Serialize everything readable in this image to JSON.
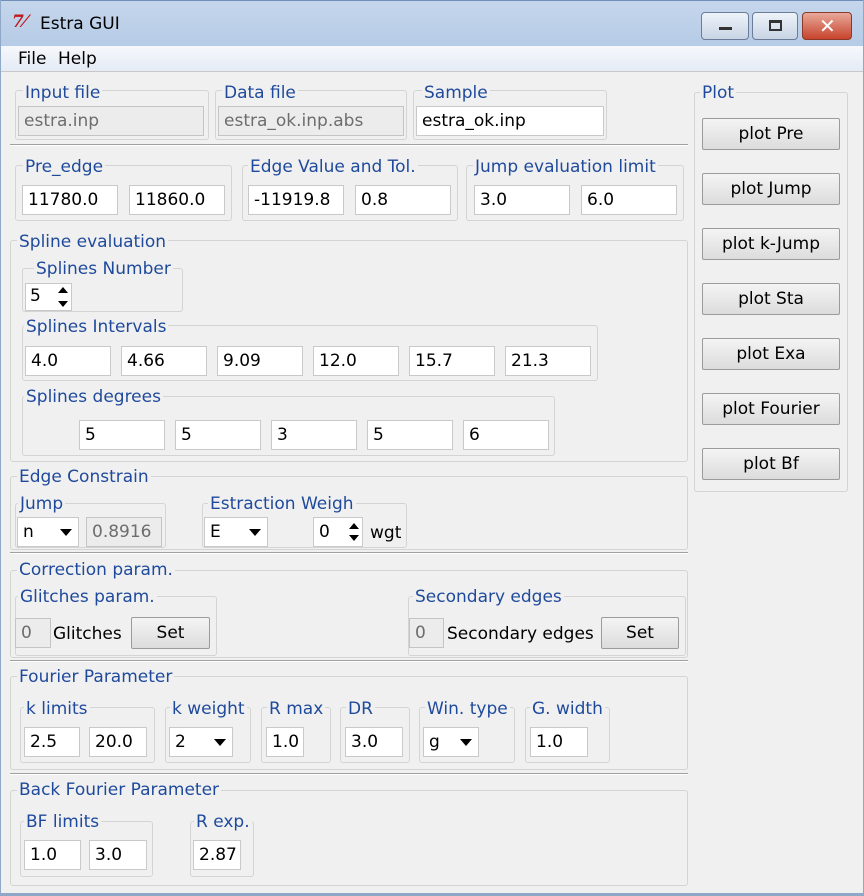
{
  "window": {
    "title": "Estra GUI",
    "icon": "tk-feather-icon"
  },
  "menu": {
    "file": "File",
    "help": "Help"
  },
  "files": {
    "input_label": "Input file",
    "input_value": "estra.inp",
    "data_label": "Data  file",
    "data_value": "estra_ok.inp.abs",
    "sample_label": "Sample",
    "sample_value": "estra_ok.inp"
  },
  "pre_edge": {
    "label": "Pre_edge",
    "v1": "11780.0",
    "v2": "11860.0"
  },
  "edge": {
    "label": "Edge Value and Tol.",
    "v1": "-11919.8",
    "v2": "0.8"
  },
  "jump_limit": {
    "label": "Jump evaluation limit",
    "v1": "3.0",
    "v2": "6.0"
  },
  "spline": {
    "label": "Spline evaluation",
    "number_label": "Splines Number",
    "number_value": "5",
    "intervals_label": "Splines Intervals",
    "intervals": [
      "4.0",
      "4.66",
      "9.09",
      "12.0",
      "15.7",
      "21.3"
    ],
    "degrees_label": "Splines degrees",
    "degrees": [
      "5",
      "5",
      "3",
      "5",
      "6"
    ]
  },
  "edge_constrain": {
    "label": "Edge Constrain",
    "jump_label": "Jump",
    "jump_value": "n",
    "jump_entry": "0.8916",
    "weigh_label": "Estraction Weigh",
    "weigh_value": "E",
    "wgt_value": "0",
    "wgt_label": "wgt"
  },
  "correction": {
    "label": "Correction param.",
    "glitches_label": "Glitches param.",
    "glitches_value": "0",
    "glitches_text": "Glitches",
    "glitches_set": "Set",
    "secondary_label": "Secondary edges",
    "secondary_value": "0",
    "secondary_text": "Secondary edges",
    "secondary_set": "Set"
  },
  "fourier": {
    "label": "Fourier Parameter",
    "klimits_label": "k limits",
    "k1": "2.5",
    "k2": "20.0",
    "kweight_label": "k weight",
    "kweight_value": "2",
    "rmax_label": "R max",
    "rmax_value": "1.0",
    "dr_label": "DR",
    "dr_value": "3.0",
    "wintype_label": "Win. type",
    "wintype_value": "g",
    "gwidth_label": "G. width",
    "gwidth_value": "1.0"
  },
  "back_fourier": {
    "label": "Back Fourier Parameter",
    "bf_label": "BF limits",
    "bf1": "1.0",
    "bf2": "3.0",
    "rexp_label": "R exp.",
    "rexp_value": "2.87"
  },
  "plot": {
    "label": "Plot",
    "buttons": [
      "plot Pre",
      "plot Jump",
      "plot k-Jump",
      "plot Sta",
      "plot Exa",
      "plot Fourier",
      "plot Bf"
    ]
  },
  "colors": {
    "label_blue": "#1f4a9c",
    "close_red": "#c7432c",
    "titlebar": "#b6cbe6"
  }
}
